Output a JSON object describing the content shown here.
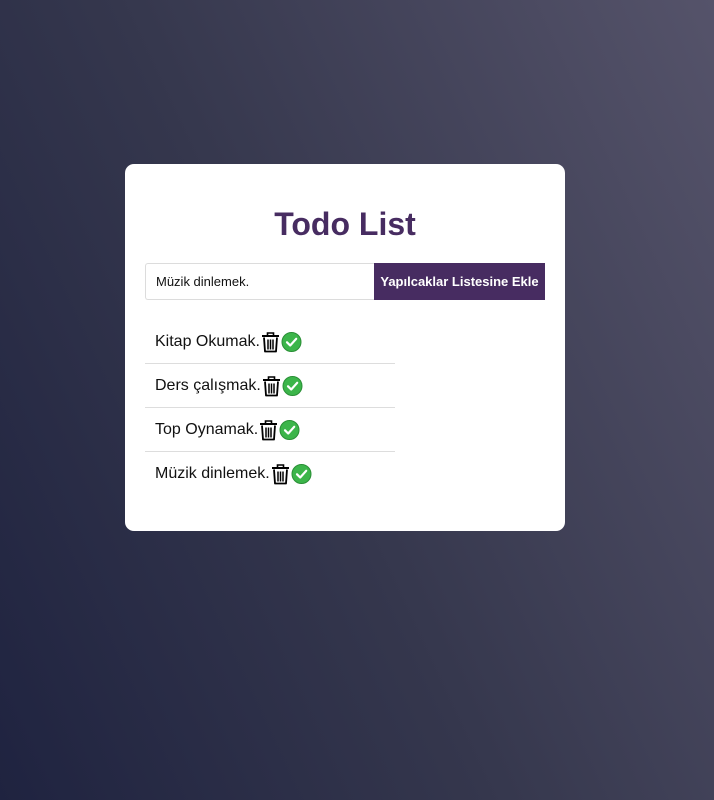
{
  "app": {
    "title": "Todo List"
  },
  "input": {
    "value": "Müzik dinlemek.",
    "placeholder": ""
  },
  "add_button": {
    "label": "Yapılcaklar Listesine Ekle"
  },
  "todos": [
    {
      "text": "Kitap Okumak.",
      "delete_icon": "trash-icon",
      "complete_icon": "check-icon"
    },
    {
      "text": "Ders çalışmak.",
      "delete_icon": "trash-icon",
      "complete_icon": "check-icon"
    },
    {
      "text": "Top Oynamak.",
      "delete_icon": "trash-icon",
      "complete_icon": "check-icon"
    },
    {
      "text": "Müzik dinlemek.",
      "delete_icon": "trash-icon",
      "complete_icon": "check-icon"
    }
  ],
  "colors": {
    "accent": "#472c61",
    "check_green": "#3cb54a",
    "card_background": "#ffffff"
  }
}
